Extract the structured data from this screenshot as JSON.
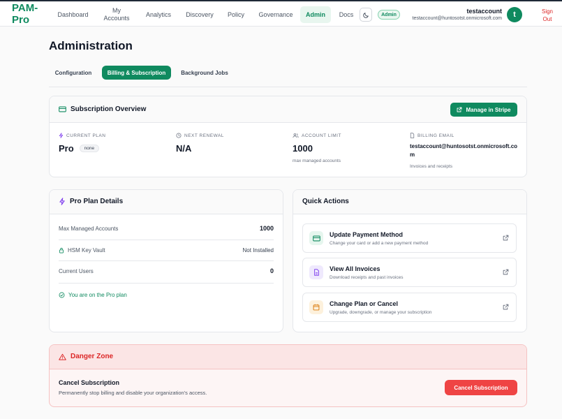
{
  "app": {
    "brand": "PAM-Pro"
  },
  "nav": {
    "items": [
      {
        "label": "Dashboard"
      },
      {
        "label": "My Accounts"
      },
      {
        "label": "Analytics"
      },
      {
        "label": "Discovery"
      },
      {
        "label": "Policy"
      },
      {
        "label": "Governance"
      },
      {
        "label": "Admin"
      },
      {
        "label": "Docs"
      }
    ],
    "active": "Admin"
  },
  "user": {
    "role_badge": "Admin",
    "name": "testaccount",
    "email": "testaccount@huntosotst.onmicrosoft.com",
    "avatar_initial": "t",
    "sign_out": "Sign Out"
  },
  "page": {
    "title": "Administration",
    "tabs": [
      {
        "label": "Configuration"
      },
      {
        "label": "Billing & Subscription"
      },
      {
        "label": "Background Jobs"
      }
    ],
    "active_tab": "Billing & Subscription"
  },
  "subscription": {
    "title": "Subscription Overview",
    "manage_button": "Manage in Stripe",
    "current_plan": {
      "label": "CURRENT PLAN",
      "value": "Pro",
      "badge": "none"
    },
    "next_renewal": {
      "label": "NEXT RENEWAL",
      "value": "N/A"
    },
    "account_limit": {
      "label": "ACCOUNT LIMIT",
      "value": "1000",
      "sub": "max managed accounts"
    },
    "billing_email": {
      "label": "BILLING EMAIL",
      "value": "testaccount@huntosotst.onmicrosoft.com",
      "sub": "Invoices and receipts"
    }
  },
  "plan_details": {
    "title": "Pro Plan Details",
    "rows": [
      {
        "label": "Max Managed Accounts",
        "value": "1000"
      },
      {
        "label": "HSM Key Vault",
        "value": "Not Installed"
      },
      {
        "label": "Current Users",
        "value": "0"
      }
    ],
    "status": "You are on the Pro plan"
  },
  "quick_actions": {
    "title": "Quick Actions",
    "items": [
      {
        "title": "Update Payment Method",
        "desc": "Change your card or add a new payment method",
        "icon": "credit-card-icon",
        "color": "#0f8a5f",
        "bg": "#e6f6ee"
      },
      {
        "title": "View All Invoices",
        "desc": "Download receipts and past invoices",
        "icon": "document-icon",
        "color": "#7c3aed",
        "bg": "#efe9fd"
      },
      {
        "title": "Change Plan or Cancel",
        "desc": "Upgrade, downgrade, or manage your subscription",
        "icon": "calendar-icon",
        "color": "#d97706",
        "bg": "#fdf1dc"
      }
    ]
  },
  "danger_zone": {
    "title": "Danger Zone",
    "item_title": "Cancel Subscription",
    "item_desc": "Permanently stop billing and disable your organization's access.",
    "button": "Cancel Subscription"
  },
  "colors": {
    "brand": "#0f8a5f",
    "danger": "#dc2626",
    "danger_button": "#ef4444"
  }
}
